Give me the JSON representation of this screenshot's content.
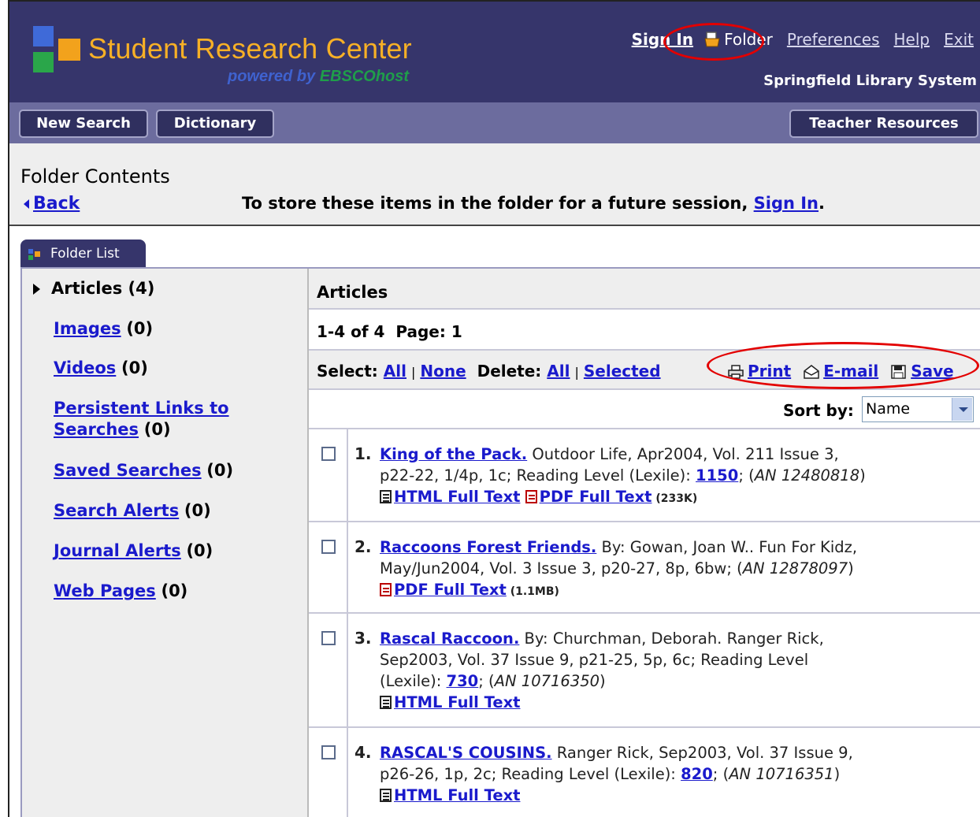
{
  "header": {
    "brand": "Student Research Center",
    "powered_prefix": "powered by ",
    "powered_brand": "EBSCOhost",
    "library": "Springfield Library System",
    "links": {
      "sign_in": "Sign In",
      "folder": "Folder",
      "preferences": "Preferences",
      "help": "Help",
      "exit": "Exit"
    },
    "colors": {
      "bar": "#36356b",
      "brand": "#f7b026",
      "highlight_circle": "#e30000"
    }
  },
  "navbar": {
    "new_search": "New Search",
    "dictionary": "Dictionary",
    "teacher_resources": "Teacher Resources"
  },
  "subheader": {
    "title": "Folder Contents",
    "back": "Back",
    "store_text": "To store these items in the folder for a future session, ",
    "store_link": "Sign In",
    "store_end": "."
  },
  "folder_tab": {
    "label": "Folder List"
  },
  "sidebar": {
    "current": {
      "label": "Articles",
      "count": "(4)"
    },
    "items": [
      {
        "label": "Images",
        "count": "(0)"
      },
      {
        "label": "Videos",
        "count": "(0)"
      },
      {
        "label": "Persistent Links to",
        "label2": "Searches",
        "count": "(0)"
      },
      {
        "label": "Saved Searches",
        "count": "(0)"
      },
      {
        "label": "Search Alerts",
        "count": "(0)"
      },
      {
        "label": "Journal Alerts",
        "count": "(0)"
      },
      {
        "label": "Web Pages",
        "count": "(0)"
      }
    ]
  },
  "main": {
    "heading": "Articles",
    "range": "1-4 of 4",
    "page_label": "Page: 1",
    "select_label": "Select:",
    "select_all": "All",
    "select_none": "None",
    "delete_label": "Delete:",
    "delete_all": "All",
    "delete_selected": "Selected",
    "sep": "|",
    "tools": {
      "print": "Print",
      "email": "E-mail",
      "save": "Save"
    },
    "sort_label": "Sort by:",
    "sort_value": "Name"
  },
  "results": [
    {
      "num": "1.",
      "title": "King of the Pack.",
      "line1": " Outdoor Life, Apr2004, Vol. 211 Issue 3,",
      "line2a": "p22-22, 1/4p, 1c; Reading Level (Lexile): ",
      "lexile": "1150",
      "semi": "; (",
      "an": "AN 12480818",
      "close": ")",
      "html": "HTML Full Text",
      "pdf": "PDF Full Text",
      "pdf_size": " (233K)"
    },
    {
      "num": "2.",
      "title": "Raccoons Forest Friends.",
      "line1": " By: Gowan, Joan W.. Fun For Kidz,",
      "line2a": "May/Jun2004, Vol. 3 Issue 3, p20-27, 8p, 6bw; (",
      "an": "AN 12878097",
      "close": ")",
      "pdf": "PDF Full Text",
      "pdf_size": " (1.1MB)"
    },
    {
      "num": "3.",
      "title": "Rascal Raccoon.",
      "line1": " By: Churchman, Deborah. Ranger Rick,",
      "line2a": "Sep2003, Vol. 37 Issue 9, p21-25, 5p, 6c; Reading Level",
      "line3a": "(Lexile): ",
      "lexile": "730",
      "semi": "; (",
      "an": "AN 10716350",
      "close": ")",
      "html": "HTML Full Text"
    },
    {
      "num": "4.",
      "title": "RASCAL'S COUSINS.",
      "line1": " Ranger Rick, Sep2003, Vol. 37 Issue 9,",
      "line2a": "p26-26, 1p, 2c; Reading Level (Lexile): ",
      "lexile": "820",
      "semi": "; (",
      "an": "AN 10716351",
      "close": ")",
      "html": "HTML Full Text"
    }
  ]
}
